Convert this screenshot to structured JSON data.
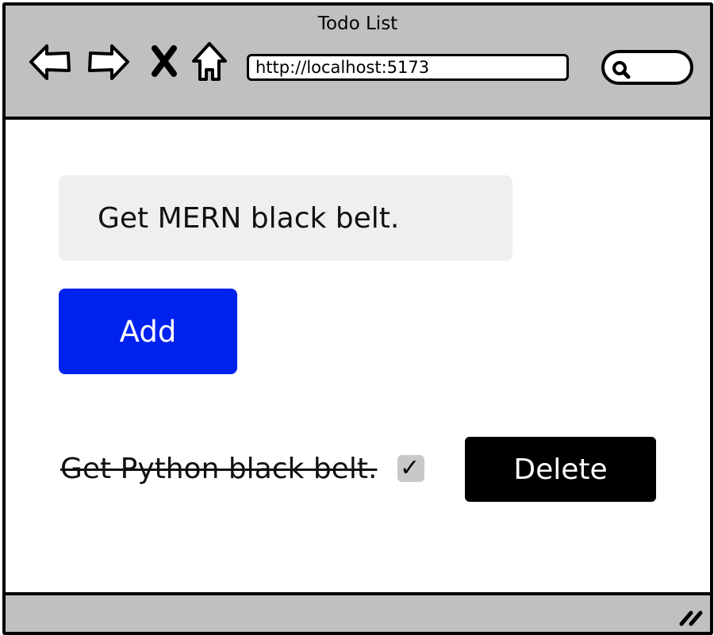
{
  "window": {
    "title": "Todo List"
  },
  "toolbar": {
    "icons": [
      "back-arrow-icon",
      "forward-arrow-icon",
      "stop-icon",
      "home-icon",
      "search-icon",
      "resize-grip-icon"
    ],
    "url": "http://localhost:5173"
  },
  "form": {
    "input_value": "Get MERN black belt.",
    "add_label": "Add",
    "add_color": "#0022ee"
  },
  "todos": [
    {
      "text": "Get Python black belt.",
      "completed": true,
      "check_mark": "✓",
      "delete_label": "Delete"
    }
  ]
}
